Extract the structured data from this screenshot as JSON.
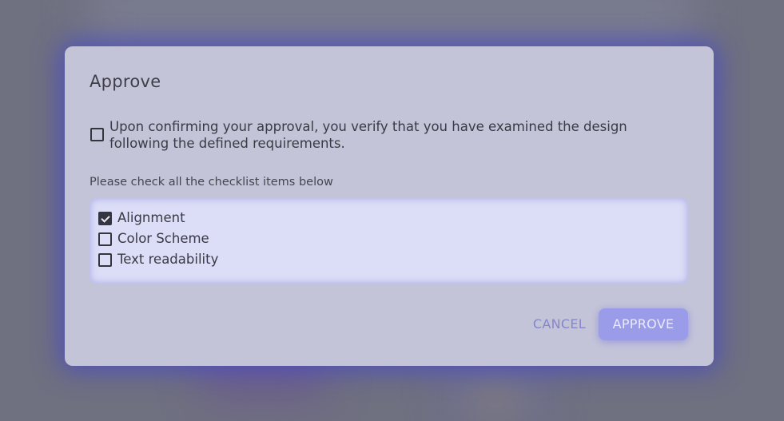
{
  "dialog": {
    "title": "Approve",
    "confirm": {
      "checked": false,
      "text": "Upon confirming your approval, you verify that you have examined the design following the defined requirements."
    },
    "hint": "Please check all the checklist items below",
    "checklist": [
      {
        "label": "Alignment",
        "checked": true
      },
      {
        "label": "Color Scheme",
        "checked": false
      },
      {
        "label": "Text readability",
        "checked": false
      }
    ],
    "actions": {
      "cancel_label": "CANCEL",
      "approve_label": "APPROVE"
    }
  },
  "colors": {
    "overlay": "#6f7080",
    "dialog_bg": "#c4c4d9",
    "dialog_glow": "#4646c8",
    "checklist_bg": "#dcddf7",
    "accent": "#9a9cea",
    "cancel_text": "#8486c8"
  }
}
